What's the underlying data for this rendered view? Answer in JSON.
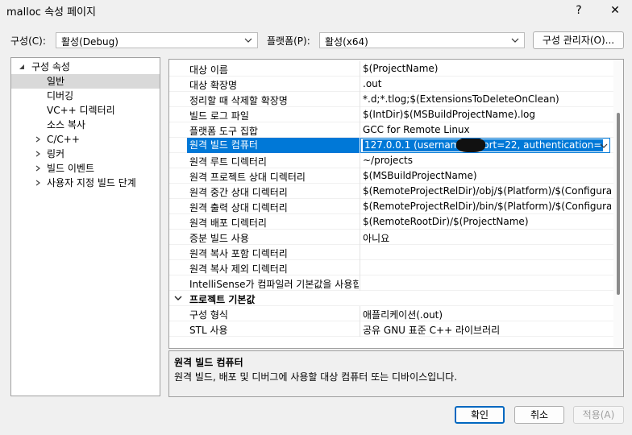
{
  "window": {
    "title": "malloc 속성 페이지",
    "help_glyph": "?",
    "close_glyph": "✕"
  },
  "config_bar": {
    "config_label": "구성(C):",
    "config_value": "활성(Debug)",
    "platform_label": "플랫폼(P):",
    "platform_value": "활성(x64)",
    "manager_button": "구성 관리자(O)..."
  },
  "tree": {
    "root": "구성 속성",
    "items": [
      {
        "label": "일반",
        "selected": true,
        "expandable": false
      },
      {
        "label": "디버깅",
        "selected": false,
        "expandable": false
      },
      {
        "label": "VC++ 디렉터리",
        "selected": false,
        "expandable": false
      },
      {
        "label": "소스 복사",
        "selected": false,
        "expandable": false
      },
      {
        "label": "C/C++",
        "selected": false,
        "expandable": true
      },
      {
        "label": "링커",
        "selected": false,
        "expandable": true
      },
      {
        "label": "빌드 이벤트",
        "selected": false,
        "expandable": true
      },
      {
        "label": "사용자 지정 빌드 단계",
        "selected": false,
        "expandable": true
      }
    ]
  },
  "grid": {
    "rows": [
      {
        "name": "대상 이름",
        "value": "$(ProjectName)"
      },
      {
        "name": "대상 확장명",
        "value": ".out"
      },
      {
        "name": "정리할 때 삭제할 확장명",
        "value": "*.d;*.tlog;$(ExtensionsToDeleteOnClean)"
      },
      {
        "name": "빌드 로그 파일",
        "value": "$(IntDir)$(MSBuildProjectName).log"
      },
      {
        "name": "플랫폼 도구 집합",
        "value": "GCC for Remote Linux"
      },
      {
        "name": "원격 빌드 컴퓨터",
        "value": "127.0.0.1 (username=       port=22, authentication=",
        "selected": true
      },
      {
        "name": "원격 루트 디렉터리",
        "value": "~/projects"
      },
      {
        "name": "원격 프로젝트 상대 디렉터리",
        "value": "$(MSBuildProjectName)"
      },
      {
        "name": "원격 중간 상대 디렉터리",
        "value": "$(RemoteProjectRelDir)/obj/$(Platform)/$(Configuration)"
      },
      {
        "name": "원격 출력 상대 디렉터리",
        "value": "$(RemoteProjectRelDir)/bin/$(Platform)/$(Configuration)"
      },
      {
        "name": "원격 배포 디렉터리",
        "value": "$(RemoteRootDir)/$(ProjectName)"
      },
      {
        "name": "증분 빌드 사용",
        "value": "아니요"
      },
      {
        "name": "원격 복사 포함 디렉터리",
        "value": ""
      },
      {
        "name": "원격 복사 제외 디렉터리",
        "value": ""
      },
      {
        "name": "IntelliSense가 컴파일러 기본값을 사용합니다",
        "value": ""
      }
    ],
    "category": "프로젝트 기본값",
    "category_rows": [
      {
        "name": "구성 형식",
        "value": "애플리케이션(.out)"
      },
      {
        "name": "STL 사용",
        "value": "공유 GNU 표준 C++ 라이브러리"
      }
    ]
  },
  "description": {
    "heading": "원격 빌드 컴퓨터",
    "text": "원격 빌드, 배포 및 디버그에 사용할 대상 컴퓨터 또는 디바이스입니다."
  },
  "footer": {
    "ok": "확인",
    "cancel": "취소",
    "apply": "적용(A)"
  },
  "colors": {
    "accent": "#0078d7",
    "selection_gray": "#d9d9d9"
  }
}
